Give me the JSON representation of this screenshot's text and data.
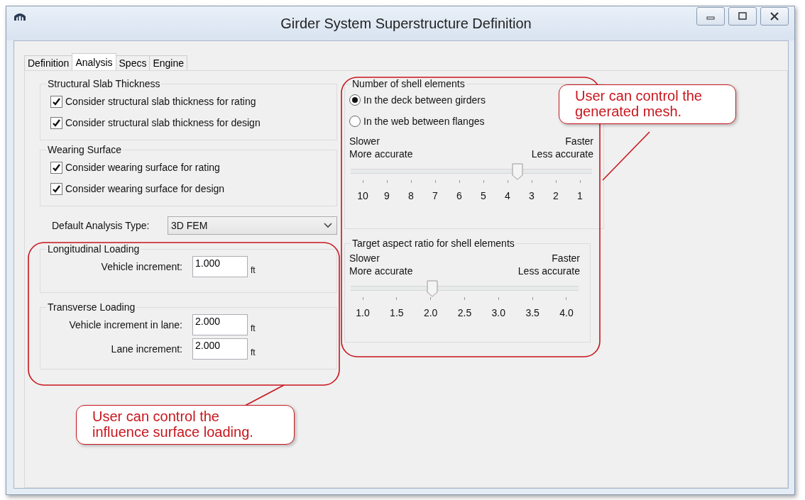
{
  "window": {
    "title": "Girder System Superstructure Definition"
  },
  "tabs": [
    {
      "label": "Definition",
      "selected": false
    },
    {
      "label": "Analysis",
      "selected": true
    },
    {
      "label": "Specs",
      "selected": false
    },
    {
      "label": "Engine",
      "selected": false
    }
  ],
  "slab_group": {
    "title": "Structural Slab Thickness",
    "checkboxes": [
      {
        "label": "Consider structural slab thickness for rating",
        "checked": true
      },
      {
        "label": "Consider structural slab thickness for design",
        "checked": true
      }
    ]
  },
  "wearing_group": {
    "title": "Wearing Surface",
    "checkboxes": [
      {
        "label": "Consider wearing surface for rating",
        "checked": true
      },
      {
        "label": "Consider wearing surface for design",
        "checked": true
      }
    ]
  },
  "analysis_type": {
    "label": "Default Analysis Type:",
    "value": "3D FEM"
  },
  "longitudinal_group": {
    "title": "Longitudinal Loading",
    "fields": [
      {
        "label": "Vehicle increment:",
        "value": "1.000",
        "unit": "ft"
      }
    ]
  },
  "transverse_group": {
    "title": "Transverse Loading",
    "fields": [
      {
        "label": "Vehicle increment in lane:",
        "value": "2.000",
        "unit": "ft"
      },
      {
        "label": "Lane increment:",
        "value": "2.000",
        "unit": "ft"
      }
    ]
  },
  "shell_group": {
    "title": "Number of shell elements",
    "radios": [
      {
        "label": "In the deck between girders",
        "selected": true
      },
      {
        "label": "In the web between flanges",
        "selected": false
      }
    ],
    "slider": {
      "left_top": "Slower",
      "left_bottom": "More accurate",
      "right_top": "Faster",
      "right_bottom": "Less accurate",
      "level": 0.667,
      "ticks": [
        "10",
        "9",
        "8",
        "7",
        "6",
        "5",
        "4",
        "3",
        "2",
        "1"
      ]
    }
  },
  "aspect_group": {
    "title": "Target aspect ratio for shell elements",
    "slider": {
      "left_top": "Slower",
      "left_bottom": "More accurate",
      "right_top": "Faster",
      "right_bottom": "Less accurate",
      "level": 0.333,
      "ticks": [
        "1.0",
        "1.5",
        "2.0",
        "2.5",
        "3.0",
        "3.5",
        "4.0"
      ]
    }
  },
  "callouts": [
    {
      "lines": [
        "User can control the",
        "influence surface loading."
      ]
    },
    {
      "lines": [
        "User can control the",
        "generated mesh."
      ]
    }
  ]
}
